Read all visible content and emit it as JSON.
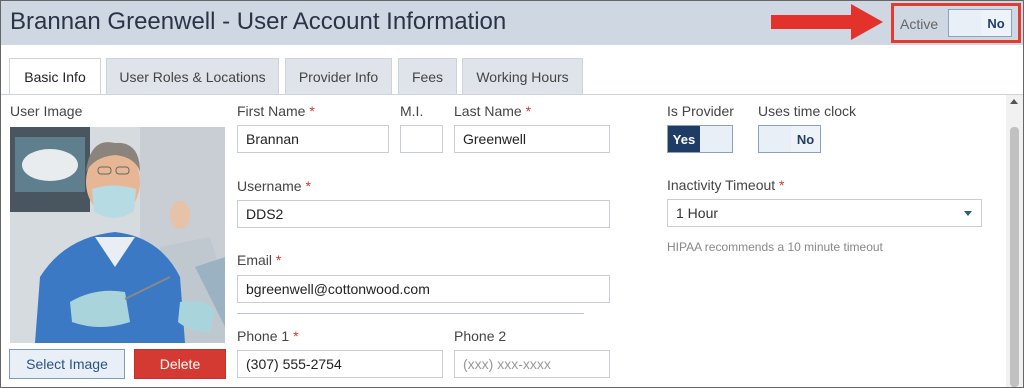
{
  "header": {
    "title": "Brannan Greenwell - User Account Information",
    "active_label": "Active",
    "active_value": "No"
  },
  "tabs": [
    {
      "label": "Basic Info",
      "active": true
    },
    {
      "label": "User Roles & Locations",
      "active": false
    },
    {
      "label": "Provider Info",
      "active": false
    },
    {
      "label": "Fees",
      "active": false
    },
    {
      "label": "Working Hours",
      "active": false
    }
  ],
  "user_image": {
    "label": "User Image",
    "select_label": "Select Image",
    "delete_label": "Delete"
  },
  "form": {
    "first_name": {
      "label": "First Name",
      "value": "Brannan"
    },
    "mi": {
      "label": "M.I.",
      "value": ""
    },
    "last_name": {
      "label": "Last Name",
      "value": "Greenwell"
    },
    "username": {
      "label": "Username",
      "value": "DDS2"
    },
    "email": {
      "label": "Email",
      "value": "bgreenwell@cottonwood.com"
    },
    "phone1": {
      "label": "Phone 1",
      "value": "(307) 555-2754"
    },
    "phone2": {
      "label": "Phone 2",
      "placeholder": "(xxx) xxx-xxxx"
    },
    "required_mark": "*"
  },
  "provider": {
    "label": "Is Provider",
    "value": "Yes"
  },
  "time_clock": {
    "label": "Uses time clock",
    "value": "No"
  },
  "inactivity": {
    "label": "Inactivity Timeout",
    "value": "1 Hour",
    "hint": "HIPAA recommends a 10 minute timeout"
  },
  "colors": {
    "accent": "#1f3c66",
    "header_bg": "#cfd7e3",
    "highlight": "#e03c31",
    "delete": "#d43a32"
  }
}
